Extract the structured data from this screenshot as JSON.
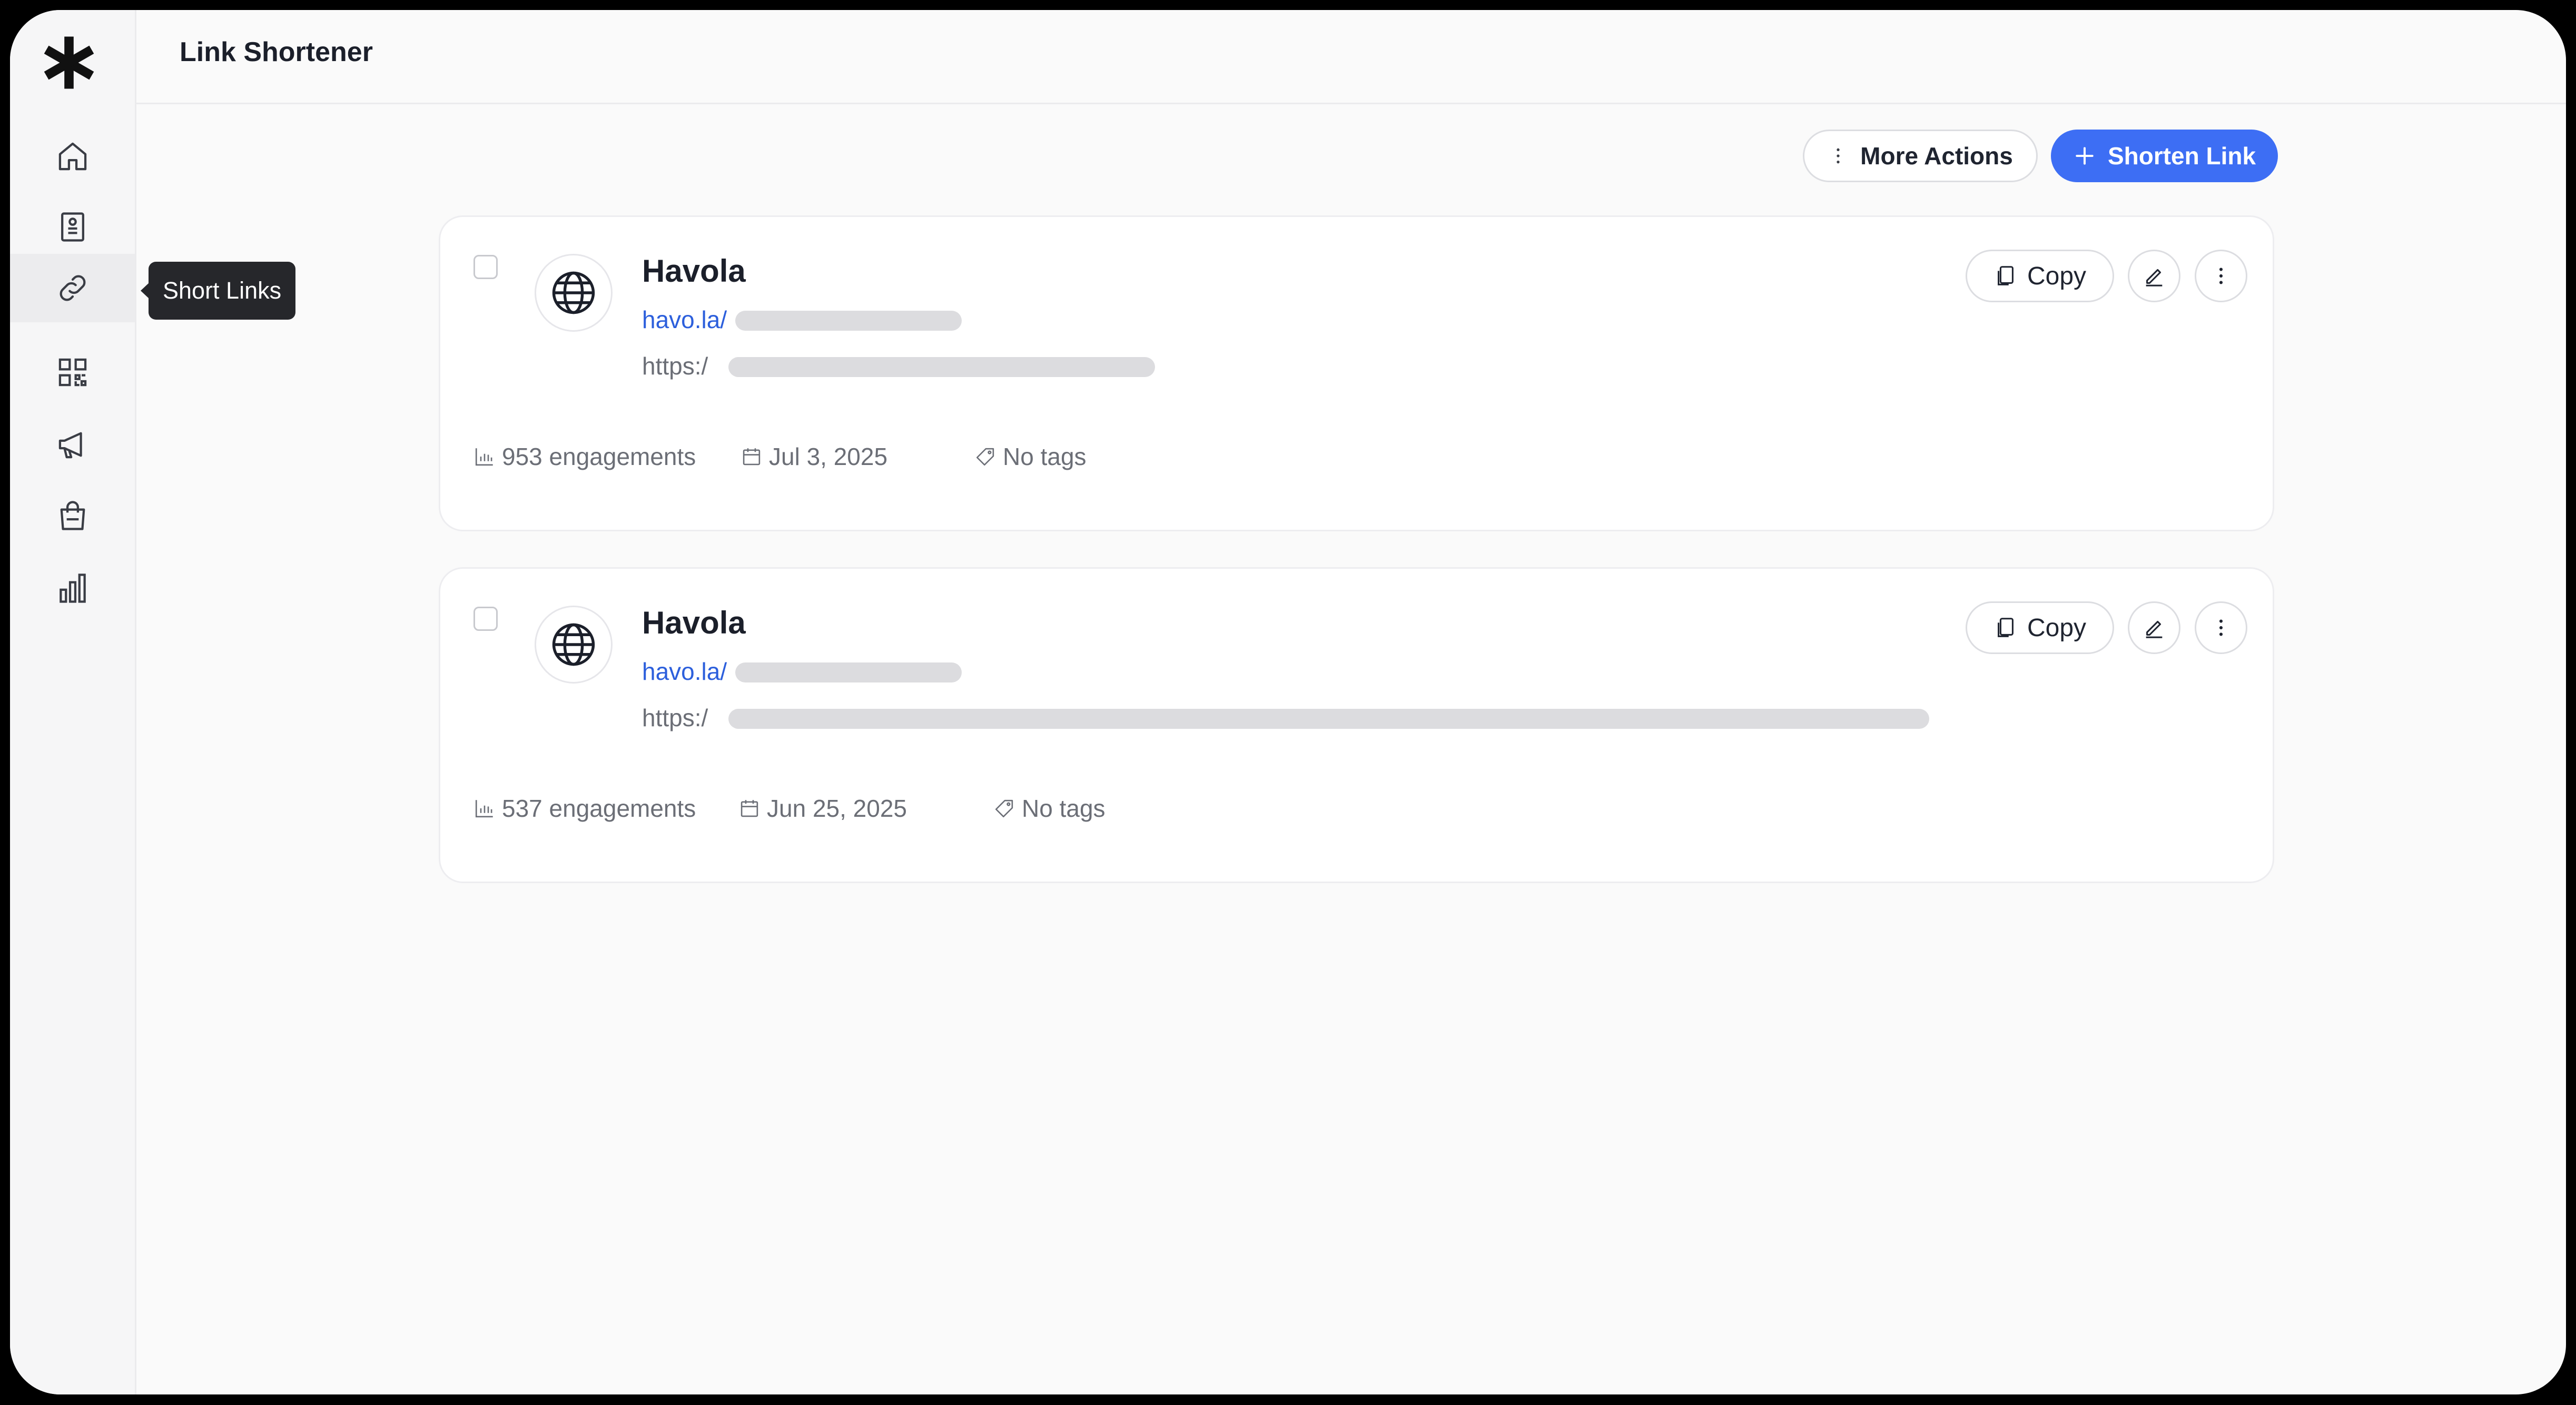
{
  "app": {
    "title": "Link Shortener"
  },
  "sidebar": {
    "items": [
      {
        "icon": "home-icon"
      },
      {
        "icon": "page-icon"
      },
      {
        "icon": "link-icon",
        "active": true
      },
      {
        "icon": "qr-code-icon"
      },
      {
        "icon": "megaphone-icon"
      },
      {
        "icon": "shopping-bag-icon"
      },
      {
        "icon": "bar-chart-icon"
      }
    ]
  },
  "tooltip": {
    "label": "Short Links"
  },
  "toolbar": {
    "more_actions_label": "More Actions",
    "shorten_label": "Shorten Link"
  },
  "links": [
    {
      "title": "Havola",
      "short_url": "havo.la/",
      "destination": "https:/",
      "engagements": "953 engagements",
      "date": "Jul 3, 2025",
      "tags": "No tags",
      "copy_label": "Copy"
    },
    {
      "title": "Havola",
      "short_url": "havo.la/",
      "destination": "https:/",
      "engagements": "537 engagements",
      "date": "Jun 25, 2025",
      "tags": "No tags",
      "copy_label": "Copy"
    }
  ],
  "colors": {
    "accent": "#3d6ef4",
    "link": "#2c5fdc",
    "tooltip_bg": "#26272b"
  }
}
